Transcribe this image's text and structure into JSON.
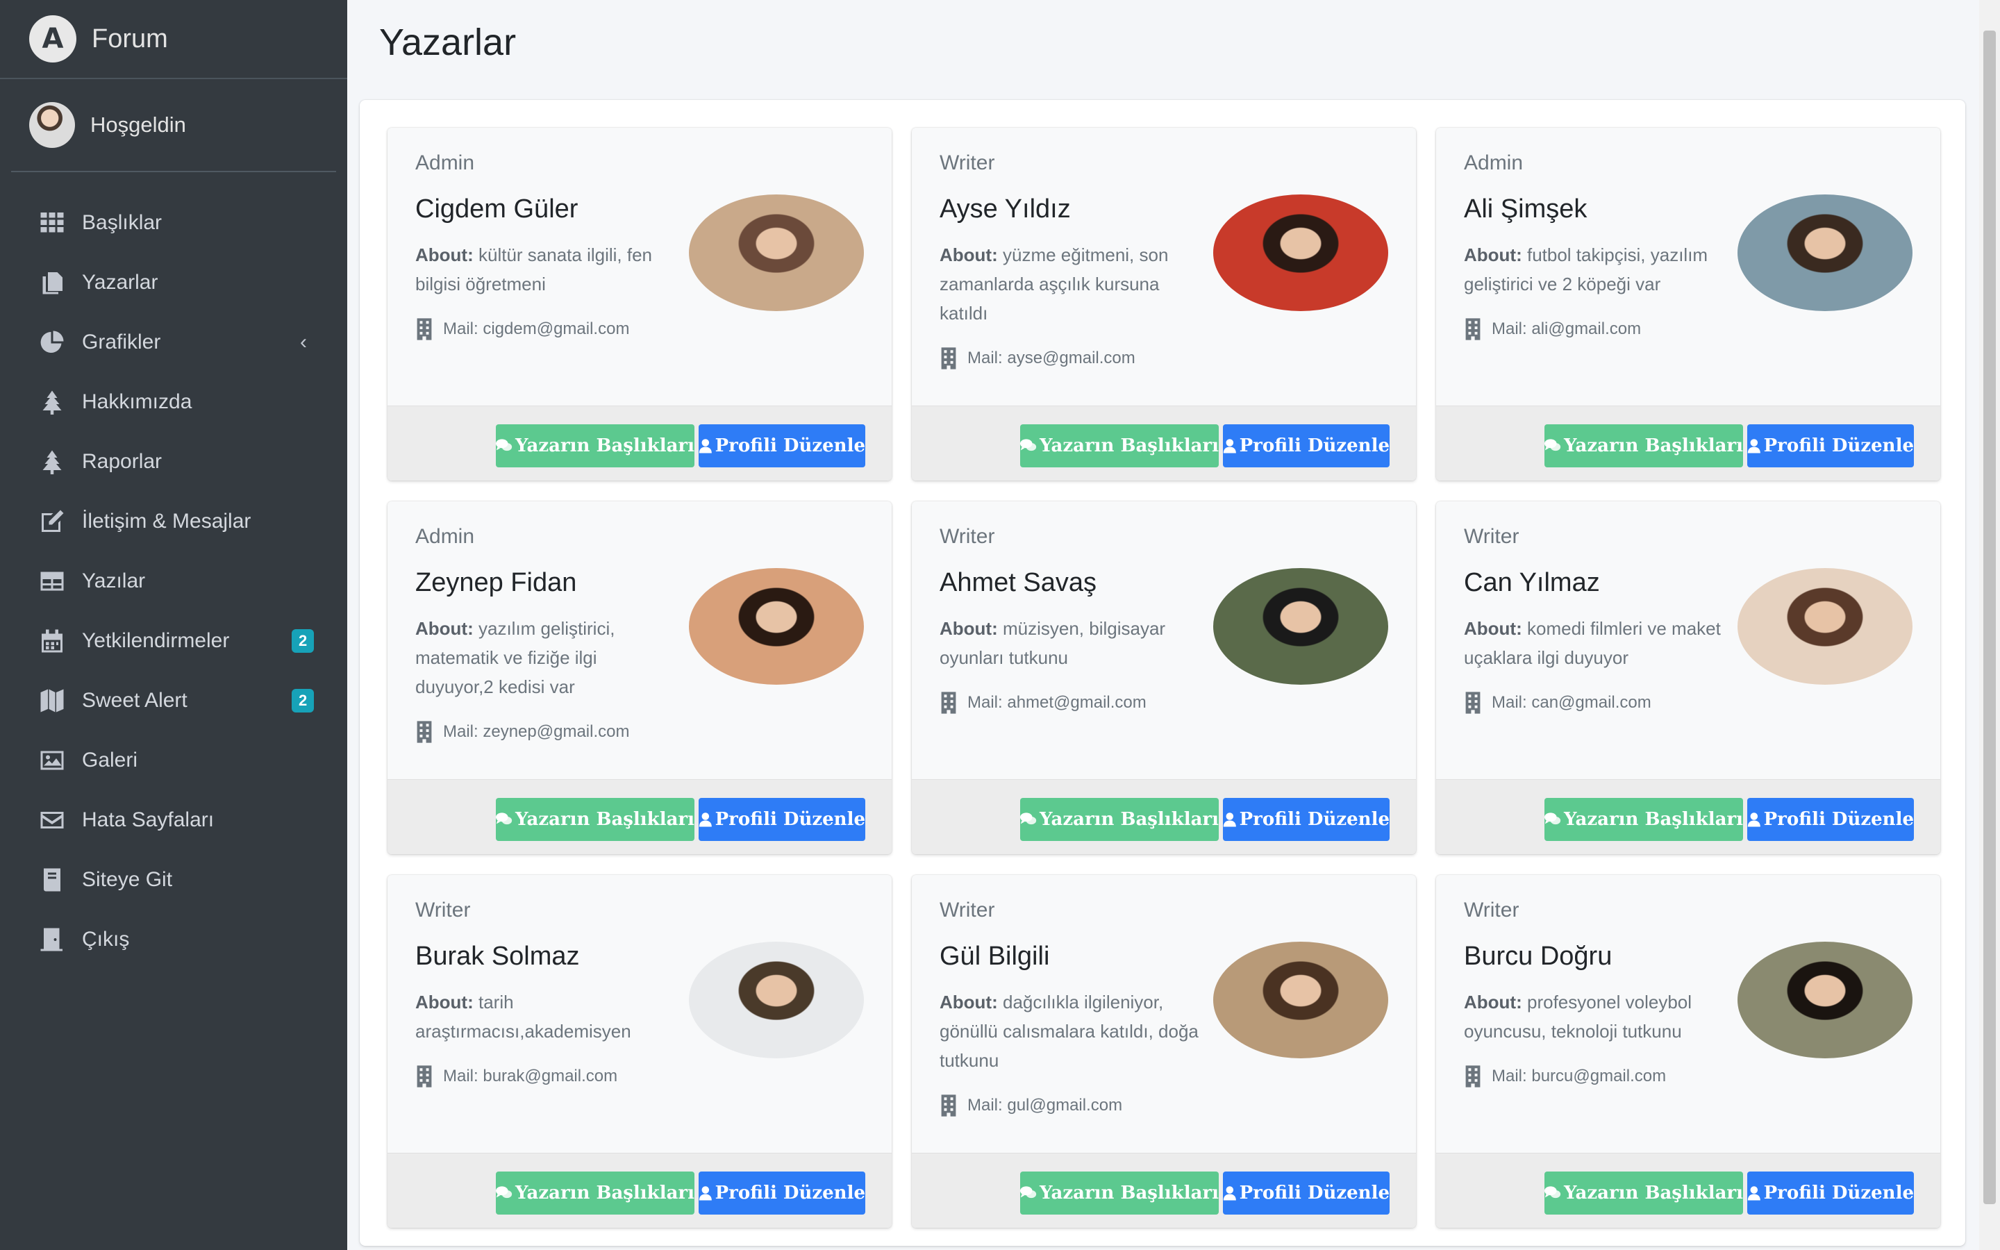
{
  "brand": {
    "name": "Forum",
    "logo_letter": "A"
  },
  "user": {
    "greeting": "Hoşgeldin"
  },
  "sidebar": {
    "items": [
      {
        "label": "Başlıklar",
        "icon": "grid-icon"
      },
      {
        "label": "Yazarlar",
        "icon": "copy-icon"
      },
      {
        "label": "Grafikler",
        "icon": "pie-chart-icon",
        "chevron": "‹"
      },
      {
        "label": "Hakkımızda",
        "icon": "tree-icon"
      },
      {
        "label": "Raporlar",
        "icon": "tree-icon"
      },
      {
        "label": "İletişim & Mesajlar",
        "icon": "edit-icon"
      },
      {
        "label": "Yazılar",
        "icon": "table-icon"
      },
      {
        "label": "Yetkilendirmeler",
        "icon": "calendar-icon",
        "badge": "2"
      },
      {
        "label": "Sweet Alert",
        "icon": "map-icon",
        "badge": "2"
      },
      {
        "label": "Galeri",
        "icon": "image-icon"
      },
      {
        "label": "Hata Sayfaları",
        "icon": "envelope-icon"
      },
      {
        "label": "Siteye Git",
        "icon": "book-icon"
      },
      {
        "label": "Çıkış",
        "icon": "door-icon"
      }
    ]
  },
  "page": {
    "title": "Yazarlar"
  },
  "labels": {
    "about": "About:",
    "mail_prefix": "Mail: ",
    "topics_button": "Yazarın Başlıkları",
    "edit_button": "Profili Düzenle"
  },
  "authors": [
    {
      "role": "Admin",
      "name": "Cigdem Güler",
      "about": "kültür sanata ilgili, fen bilgisi öğretmeni",
      "mail": "cigdem@gmail.com",
      "photo_colors": [
        "#c9a98a",
        "#6b4a3a"
      ]
    },
    {
      "role": "Writer",
      "name": "Ayse Yıldız",
      "about": "yüzme eğitmeni, son zamanlarda aşçılık kursuna katıldı",
      "mail": "ayse@gmail.com",
      "photo_colors": [
        "#c83a2a",
        "#2a1a14"
      ]
    },
    {
      "role": "Admin",
      "name": "Ali Şimşek",
      "about": "futbol takipçisi, yazılım geliştirici ve 2 köpeği var",
      "mail": "ali@gmail.com",
      "photo_colors": [
        "#7f9aa8",
        "#3a2a20"
      ]
    },
    {
      "role": "Admin",
      "name": "Zeynep Fidan",
      "about": "yazılım geliştirici, matematik ve fiziğe ilgi duyuyor,2 kedisi var",
      "mail": "zeynep@gmail.com",
      "photo_colors": [
        "#d8a07a",
        "#2a1a12"
      ]
    },
    {
      "role": "Writer",
      "name": "Ahmet Savaş",
      "about": "müzisyen, bilgisayar oyunları tutkunu",
      "mail": "ahmet@gmail.com",
      "photo_colors": [
        "#5a6a4a",
        "#1a1a1a"
      ]
    },
    {
      "role": "Writer",
      "name": "Can Yılmaz",
      "about": "komedi filmleri ve maket uçaklara ilgi duyuyor",
      "mail": "can@gmail.com",
      "photo_colors": [
        "#e6d2c0",
        "#5a3a2a"
      ]
    },
    {
      "role": "Writer",
      "name": "Burak Solmaz",
      "about": "tarih araştırmacısı,akademisyen",
      "mail": "burak@gmail.com",
      "photo_colors": [
        "#e8eaec",
        "#4a3a2a"
      ]
    },
    {
      "role": "Writer",
      "name": "Gül Bilgili",
      "about": "dağcılıkla ilgileniyor, gönüllü calısmalara katıldı, doğa tutkunu",
      "mail": "gul@gmail.com",
      "photo_colors": [
        "#b89a78",
        "#4a3222"
      ]
    },
    {
      "role": "Writer",
      "name": "Burcu Doğru",
      "about": "profesyonel voleybol oyuncusu, teknoloji tutkunu",
      "mail": "burcu@gmail.com",
      "photo_colors": [
        "#8a8a70",
        "#1a1410"
      ]
    }
  ],
  "colors": {
    "sidebar_bg": "#343a40",
    "badge": "#17a2b8",
    "btn_green": "#5cc98f",
    "btn_blue": "#2e7cf6"
  }
}
